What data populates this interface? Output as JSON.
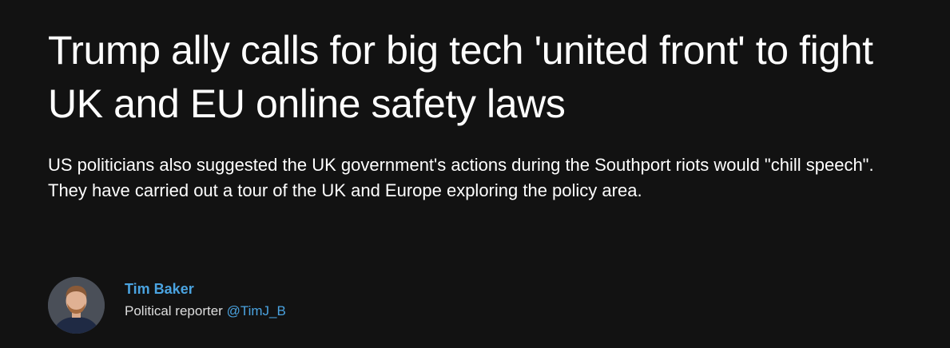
{
  "article": {
    "headline": "Trump ally calls for big tech 'united front' to fight UK and EU online safety laws",
    "standfirst": "US politicians also suggested the UK government's actions during the Southport riots would \"chill speech\". They have carried out a tour of the UK and Europe exploring the policy area."
  },
  "author": {
    "name": "Tim Baker",
    "role": "Political reporter",
    "handle": "@TimJ_B",
    "avatar_icon": "person-avatar"
  },
  "colors": {
    "background": "#121212",
    "text": "#ffffff",
    "accent_link": "#4aa3e0"
  }
}
